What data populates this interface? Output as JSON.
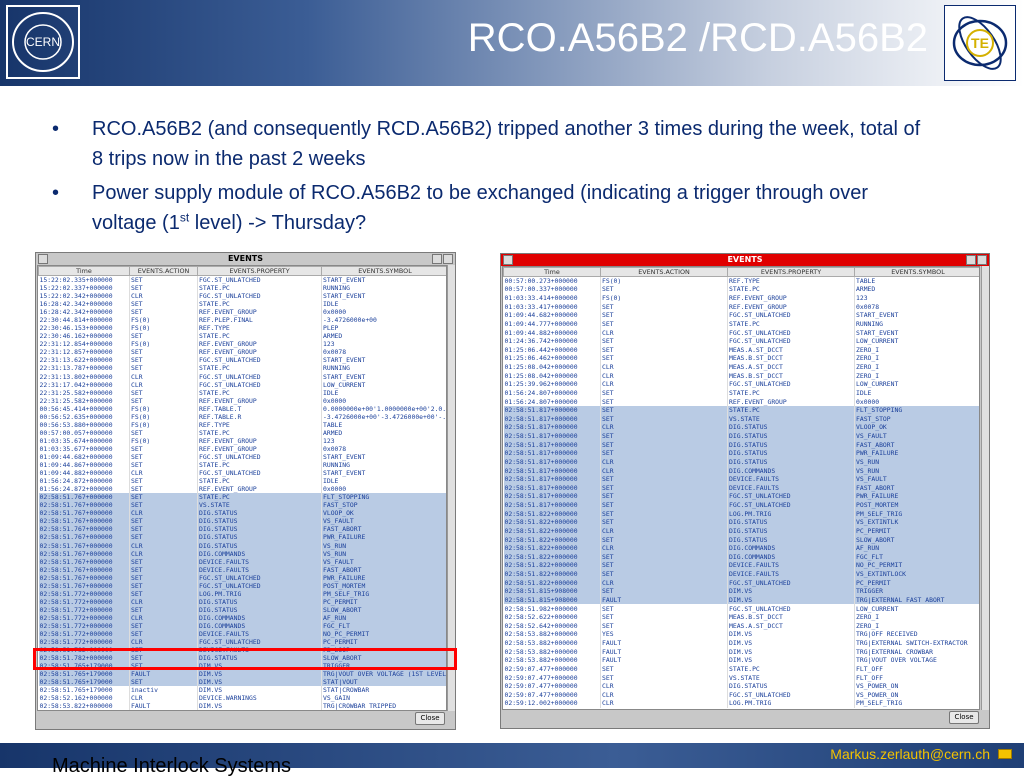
{
  "slide": {
    "title": "RCO.A56B2 /RCD.A56B2",
    "te_label": "TE",
    "cern_label": "CERN",
    "footer_left": "Machine Interlock Systems",
    "footer_right": "Markus.zerlauth@cern.ch"
  },
  "bullets": [
    {
      "text": "RCO.A56B2 (and consequently RCD.A56B2) tripped another 3 times during the week, total of 8 trips now in the past 2 weeks"
    },
    {
      "pre": "Power supply module of RCO.A56B2 to be exchanged (indicating a trigger through over voltage (1",
      "sup": "st",
      "post": " level)  -> Thursday?"
    }
  ],
  "window1": {
    "title": "EVENTS",
    "columns": [
      "Time",
      "EVENTS.ACTION",
      "EVENTS.PROPERTY",
      "EVENTS.SYMBOL"
    ],
    "close": "Close",
    "rows": [
      [
        "15:22:02.335+000000",
        "SET",
        "FGC.ST_UNLATCHED",
        "START_EVENT",
        0
      ],
      [
        "15:22:02.337+000000",
        "SET",
        "STATE.PC",
        "RUNNING",
        0
      ],
      [
        "15:22:02.342+000000",
        "CLR",
        "FGC.ST_UNLATCHED",
        "START_EVENT",
        0
      ],
      [
        "16:28:42.342+000000",
        "SET",
        "STATE.PC",
        "IDLE",
        0
      ],
      [
        "16:28:42.342+000000",
        "SET",
        "REF.EVENT_GROUP",
        "0x0000",
        0
      ],
      [
        "22:30:44.814+000000",
        "FS(0)",
        "REF.PLEP.FINAL",
        "-3.4726000e+00",
        0
      ],
      [
        "22:30:46.153+000000",
        "FS(0)",
        "REF.TYPE",
        "PLEP",
        0
      ],
      [
        "22:30:46.162+000000",
        "SET",
        "STATE.PC",
        "ARMED",
        0
      ],
      [
        "22:31:12.854+000000",
        "FS(0)",
        "REF.EVENT_GROUP",
        "123",
        0
      ],
      [
        "22:31:12.857+000000",
        "SET",
        "REF.EVENT_GROUP",
        "0x0078",
        0
      ],
      [
        "22:31:13.622+000000",
        "SET",
        "FGC.ST_UNLATCHED",
        "START_EVENT",
        0
      ],
      [
        "22:31:13.787+000000",
        "SET",
        "STATE.PC",
        "RUNNING",
        0
      ],
      [
        "22:31:13.802+000000",
        "CLR",
        "FGC.ST_UNLATCHED",
        "START_EVENT",
        0
      ],
      [
        "22:31:17.042+000000",
        "CLR",
        "FGC.ST_UNLATCHED",
        "LOW_CURRENT",
        0
      ],
      [
        "22:31:25.582+000000",
        "SET",
        "STATE.PC",
        "IDLE",
        0
      ],
      [
        "22:31:25.582+000000",
        "SET",
        "REF.EVENT_GROUP",
        "0x0000",
        0
      ],
      [
        "00:56:45.414+000000",
        "FS(0)",
        "REF.TABLE.T",
        "0.0000000e+00'1.0000000e+00'2.0...",
        0
      ],
      [
        "00:56:52.635+000000",
        "FS(0)",
        "REF.TABLE.R",
        "-3.4726000e+00'-3.4726000e+00'-...",
        0
      ],
      [
        "00:56:53.880+000000",
        "FS(0)",
        "REF.TYPE",
        "TABLE",
        0
      ],
      [
        "00:57:00.057+000000",
        "SET",
        "STATE.PC",
        "ARMED",
        0
      ],
      [
        "01:03:35.674+000000",
        "FS(0)",
        "REF.EVENT_GROUP",
        "123",
        0
      ],
      [
        "01:03:35.677+000000",
        "SET",
        "REF.EVENT_GROUP",
        "0x0078",
        0
      ],
      [
        "01:09:44.682+000000",
        "SET",
        "FGC.ST_UNLATCHED",
        "START_EVENT",
        0
      ],
      [
        "01:09:44.867+000000",
        "SET",
        "STATE.PC",
        "RUNNING",
        0
      ],
      [
        "01:09:44.882+000000",
        "CLR",
        "FGC.ST_UNLATCHED",
        "START_EVENT",
        0
      ],
      [
        "01:56:24.872+000000",
        "SET",
        "STATE.PC",
        "IDLE",
        0
      ],
      [
        "01:56:24.872+000000",
        "SET",
        "REF.EVENT_GROUP",
        "0x0000",
        0
      ],
      [
        "02:58:51.767+000000",
        "SET",
        "STATE.PC",
        "FLT_STOPPING",
        1
      ],
      [
        "02:58:51.767+000000",
        "SET",
        "VS.STATE",
        "FAST_STOP",
        1
      ],
      [
        "02:58:51.767+000000",
        "CLR",
        "DIG.STATUS",
        "VLOOP_OK",
        1
      ],
      [
        "02:58:51.767+000000",
        "SET",
        "DIG.STATUS",
        "VS_FAULT",
        1
      ],
      [
        "02:58:51.767+000000",
        "SET",
        "DIG.STATUS",
        "FAST_ABORT",
        1
      ],
      [
        "02:58:51.767+000000",
        "SET",
        "DIG.STATUS",
        "PWR_FAILURE",
        1
      ],
      [
        "02:58:51.767+000000",
        "CLR",
        "DIG.STATUS",
        "VS_RUN",
        1
      ],
      [
        "02:58:51.767+000000",
        "CLR",
        "DIG.COMMANDS",
        "VS_RUN",
        1
      ],
      [
        "02:58:51.767+000000",
        "SET",
        "DEVICE.FAULTS",
        "VS_FAULT",
        1
      ],
      [
        "02:58:51.767+000000",
        "SET",
        "DEVICE.FAULTS",
        "FAST_ABORT",
        1
      ],
      [
        "02:58:51.767+000000",
        "SET",
        "FGC.ST_UNLATCHED",
        "PWR_FAILURE",
        1
      ],
      [
        "02:58:51.767+000000",
        "SET",
        "FGC.ST_UNLATCHED",
        "POST_MORTEM",
        1
      ],
      [
        "02:58:51.772+000000",
        "SET",
        "LOG.PM.TRIG",
        "PM_SELF_TRIG",
        1
      ],
      [
        "02:58:51.772+000000",
        "CLR",
        "DIG.STATUS",
        "PC_PERMIT",
        1
      ],
      [
        "02:58:51.772+000000",
        "SET",
        "DIG.STATUS",
        "SLOW_ABORT",
        1
      ],
      [
        "02:58:51.772+000000",
        "CLR",
        "DIG.COMMANDS",
        "AF_RUN",
        1
      ],
      [
        "02:58:51.772+000000",
        "SET",
        "DIG.COMMANDS",
        "FGC_FLT",
        1
      ],
      [
        "02:58:51.772+000000",
        "SET",
        "DEVICE.FAULTS",
        "NO_PC_PERMIT",
        1
      ],
      [
        "02:58:51.772+000000",
        "CLR",
        "FGC.ST_UNLATCHED",
        "PC_PERMIT",
        1
      ],
      [
        "02:58:51.782+000000",
        "SET",
        "DEVICE.FAULTS",
        "FB_LOOP",
        1
      ],
      [
        "02:58:51.782+000000",
        "SET",
        "DIG.STATUS",
        "SLOW_ABORT",
        1
      ],
      [
        "02:58:51.765+179000",
        "SET",
        "DIM.VS",
        "TRIGGER",
        1
      ],
      [
        "02:58:51.765+179000",
        "FAULT",
        "DIM.VS",
        "TRG|VOUT OVER VOLTAGE (1ST LEVEL)",
        1
      ],
      [
        "02:58:51.765+179000",
        "SET",
        "DIM.VS",
        "STAT|VOUT",
        1
      ],
      [
        "02:58:51.765+179000",
        "inactiv",
        "DIM.VS",
        "STAT|CROWBAR",
        0
      ],
      [
        "02:58:52.162+000000",
        "CLR",
        "DEVICE.WARNINGS",
        "VS_GAIN",
        0
      ],
      [
        "02:58:53.822+000000",
        "FAULT",
        "DIM.VS",
        "TRG|CROWBAR TRIPPED",
        0
      ],
      [
        "02:59:11.002+000000",
        "CLR",
        "LOG.PM.TRIG",
        "PM_SELF_TRIG",
        0
      ]
    ]
  },
  "window2": {
    "title": "EVENTS",
    "columns": [
      "Time",
      "EVENTS.ACTION",
      "EVENTS.PROPERTY",
      "EVENTS.SYMBOL"
    ],
    "close": "Close",
    "rows": [
      [
        "00:57:00.273+000000",
        "FS(0)",
        "REF.TYPE",
        "TABLE",
        0
      ],
      [
        "00:57:00.337+000000",
        "SET",
        "STATE.PC",
        "ARMED",
        0
      ],
      [
        "01:03:33.414+000000",
        "FS(0)",
        "REF.EVENT_GROUP",
        "123",
        0
      ],
      [
        "01:03:33.417+000000",
        "SET",
        "REF.EVENT_GROUP",
        "0x0078",
        0
      ],
      [
        "01:09:44.682+000000",
        "SET",
        "FGC.ST_UNLATCHED",
        "START_EVENT",
        0
      ],
      [
        "01:09:44.777+000000",
        "SET",
        "STATE.PC",
        "RUNNING",
        0
      ],
      [
        "01:09:44.882+000000",
        "CLR",
        "FGC.ST_UNLATCHED",
        "START_EVENT",
        0
      ],
      [
        "01:24:36.742+000000",
        "SET",
        "FGC.ST_UNLATCHED",
        "LOW_CURRENT",
        0
      ],
      [
        "01:25:06.442+000000",
        "SET",
        "MEAS.A.ST_DCCT",
        "ZERO_I",
        0
      ],
      [
        "01:25:06.462+000000",
        "SET",
        "MEAS.B.ST_DCCT",
        "ZERO_I",
        0
      ],
      [
        "01:25:08.042+000000",
        "CLR",
        "MEAS.A.ST_DCCT",
        "ZERO_I",
        0
      ],
      [
        "01:25:08.042+000000",
        "CLR",
        "MEAS.B.ST_DCCT",
        "ZERO_I",
        0
      ],
      [
        "01:25:39.962+000000",
        "CLR",
        "FGC.ST_UNLATCHED",
        "LOW_CURRENT",
        0
      ],
      [
        "01:56:24.807+000000",
        "SET",
        "STATE.PC",
        "IDLE",
        0
      ],
      [
        "01:56:24.807+000000",
        "SET",
        "REF.EVENT_GROUP",
        "0x0000",
        0
      ],
      [
        "02:58:51.817+000000",
        "SET",
        "STATE.PC",
        "FLT_STOPPING",
        1
      ],
      [
        "02:58:51.817+000000",
        "SET",
        "VS.STATE",
        "FAST_STOP",
        1
      ],
      [
        "02:58:51.817+000000",
        "CLR",
        "DIG.STATUS",
        "VLOOP_OK",
        1
      ],
      [
        "02:58:51.817+000000",
        "SET",
        "DIG.STATUS",
        "VS_FAULT",
        1
      ],
      [
        "02:58:51.817+000000",
        "SET",
        "DIG.STATUS",
        "FAST_ABORT",
        1
      ],
      [
        "02:58:51.817+000000",
        "SET",
        "DIG.STATUS",
        "PWR_FAILURE",
        1
      ],
      [
        "02:58:51.817+000000",
        "CLR",
        "DIG.STATUS",
        "VS_RUN",
        1
      ],
      [
        "02:58:51.817+000000",
        "CLR",
        "DIG.COMMANDS",
        "VS_RUN",
        1
      ],
      [
        "02:58:51.817+000000",
        "SET",
        "DEVICE.FAULTS",
        "VS_FAULT",
        1
      ],
      [
        "02:58:51.817+000000",
        "SET",
        "DEVICE.FAULTS",
        "FAST_ABORT",
        1
      ],
      [
        "02:58:51.817+000000",
        "SET",
        "FGC.ST_UNLATCHED",
        "PWR_FAILURE",
        1
      ],
      [
        "02:58:51.817+000000",
        "SET",
        "FGC.ST_UNLATCHED",
        "POST_MORTEM",
        1
      ],
      [
        "02:58:51.822+000000",
        "SET",
        "LOG.PM.TRIG",
        "PM_SELF_TRIG",
        1
      ],
      [
        "02:58:51.822+000000",
        "SET",
        "DIG.STATUS",
        "VS_EXTINTLK",
        1
      ],
      [
        "02:58:51.822+000000",
        "CLR",
        "DIG.STATUS",
        "PC_PERMIT",
        1
      ],
      [
        "02:58:51.822+000000",
        "SET",
        "DIG.STATUS",
        "SLOW_ABORT",
        1
      ],
      [
        "02:58:51.822+000000",
        "CLR",
        "DIG.COMMANDS",
        "AF_RUN",
        1
      ],
      [
        "02:58:51.822+000000",
        "SET",
        "DIG.COMMANDS",
        "FGC_FLT",
        1
      ],
      [
        "02:58:51.822+000000",
        "SET",
        "DEVICE.FAULTS",
        "NO_PC_PERMIT",
        1
      ],
      [
        "02:58:51.822+000000",
        "SET",
        "DEVICE.FAULTS",
        "VS_EXTINTLOCK",
        1
      ],
      [
        "02:58:51.822+000000",
        "CLR",
        "FGC.ST_UNLATCHED",
        "PC_PERMIT",
        1
      ],
      [
        "02:58:51.815+908000",
        "SET",
        "DIM.VS",
        "TRIGGER",
        1
      ],
      [
        "02:58:51.815+908000",
        "FAULT",
        "DIM.VS",
        "TRG|EXTERNAL FAST ABORT",
        1
      ],
      [
        "02:58:51.982+000000",
        "SET",
        "FGC.ST_UNLATCHED",
        "LOW_CURRENT",
        0
      ],
      [
        "02:58:52.622+000000",
        "SET",
        "MEAS.B.ST_DCCT",
        "ZERO_I",
        0
      ],
      [
        "02:58:52.642+000000",
        "SET",
        "MEAS.A.ST_DCCT",
        "ZERO_I",
        0
      ],
      [
        "02:58:53.882+000000",
        "YES",
        "DIM.VS",
        "TRG|OFF RECEIVED",
        0
      ],
      [
        "02:58:53.882+000000",
        "FAULT",
        "DIM.VS",
        "TRG|EXTERNAL SWITCH-EXTRACTOR",
        0
      ],
      [
        "02:58:53.882+000000",
        "FAULT",
        "DIM.VS",
        "TRG|EXTERNAL CROWBAR",
        0
      ],
      [
        "02:58:53.882+000000",
        "FAULT",
        "DIM.VS",
        "TRG|VOUT OVER VOLTAGE",
        0
      ],
      [
        "02:59:07.477+000000",
        "SET",
        "STATE.PC",
        "FLT_OFF",
        0
      ],
      [
        "02:59:07.477+000000",
        "SET",
        "VS.STATE",
        "FLT_OFF",
        0
      ],
      [
        "02:59:07.477+000000",
        "CLR",
        "DIG.STATUS",
        "VS_POWER_ON",
        0
      ],
      [
        "02:59:07.477+000000",
        "CLR",
        "FGC.ST_UNLATCHED",
        "VS_POWER_ON",
        0
      ],
      [
        "02:59:12.002+000000",
        "CLR",
        "LOG.PM.TRIG",
        "PM_SELF_TRIG",
        0
      ]
    ]
  },
  "colors": {
    "header_dark": "#17356a",
    "bullet_text": "#0b2a6f",
    "row_text": "#1a3f9a",
    "row_selected": "#b9cbe4",
    "highlight": "#ff0000",
    "events_title_red": "#e00000",
    "email": "#f3c200"
  },
  "icons": [
    "cern-logo-icon",
    "te-logo-icon",
    "mail-icon"
  ]
}
